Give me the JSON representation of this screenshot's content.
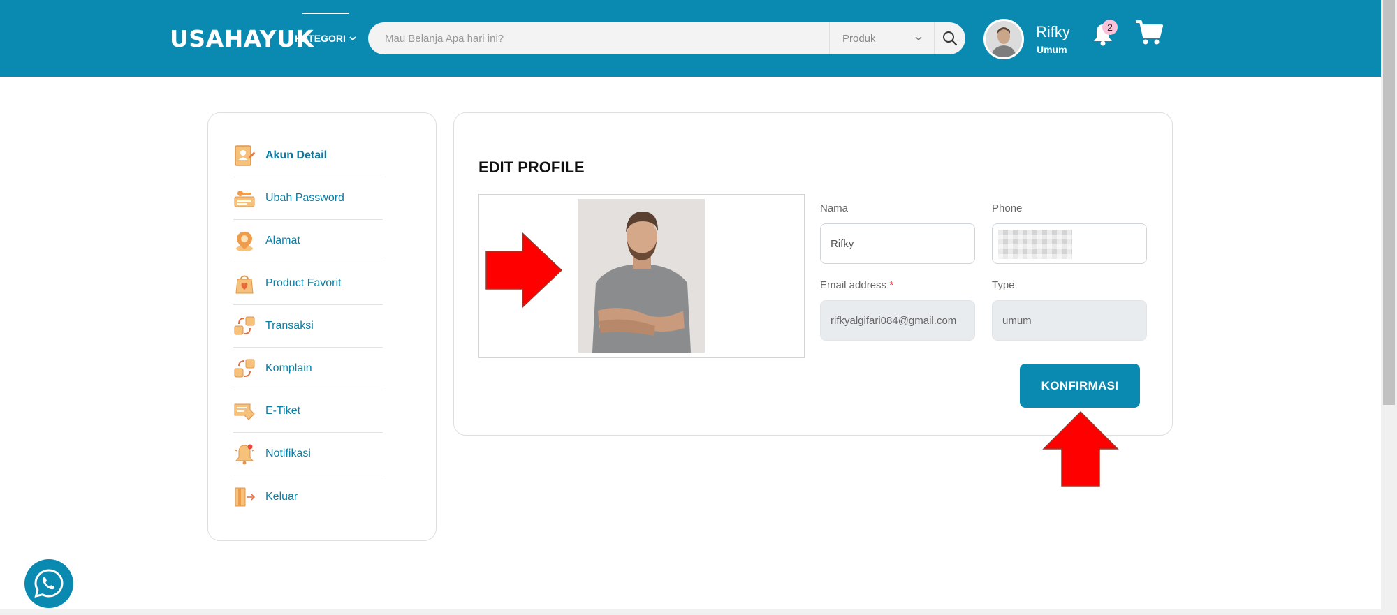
{
  "header": {
    "logo": "USAHAYUK",
    "kategori_label": "KATEGORI",
    "search_placeholder": "Mau Belanja Apa hari ini?",
    "search_category": "Produk",
    "user_name": "Rifky",
    "user_type": "Umum",
    "notification_count": "2"
  },
  "sidebar": {
    "items": [
      {
        "label": "Akun Detail",
        "icon": "account-detail-icon"
      },
      {
        "label": "Ubah Password",
        "icon": "key-icon"
      },
      {
        "label": "Alamat",
        "icon": "location-icon"
      },
      {
        "label": "Product Favorit",
        "icon": "favorite-bag-icon"
      },
      {
        "label": "Transaksi",
        "icon": "transaction-icon"
      },
      {
        "label": "Komplain",
        "icon": "complaint-icon"
      },
      {
        "label": "E-Tiket",
        "icon": "ticket-icon"
      },
      {
        "label": "Notifikasi",
        "icon": "bell-icon"
      },
      {
        "label": "Keluar",
        "icon": "logout-icon"
      }
    ]
  },
  "profile": {
    "title": "EDIT PROFILE",
    "name_label": "Nama",
    "name_value": "Rifky",
    "phone_label": "Phone",
    "email_label": "Email address",
    "email_required": "*",
    "email_value": "rifkyalgifari084@gmail.com",
    "type_label": "Type",
    "type_value": "umum",
    "submit_label": "KONFIRMASI"
  },
  "colors": {
    "primary": "#0a8ab0",
    "accent_red": "#ff0000",
    "sidebar_text": "#0a7fa5"
  }
}
